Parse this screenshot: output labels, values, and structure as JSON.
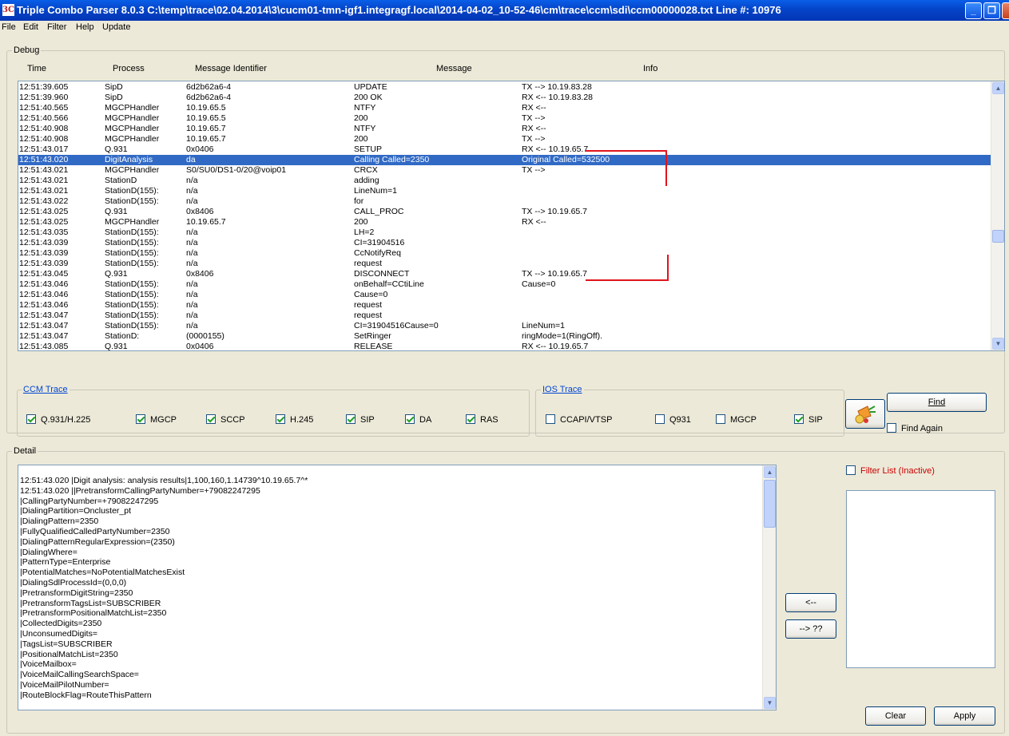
{
  "window": {
    "title": "Triple Combo Parser 8.0.3 C:\\temp\\trace\\02.04.2014\\3\\cucm01-tmn-igf1.integragf.local\\2014-04-02_10-52-46\\cm\\trace\\ccm\\sdi\\ccm00000028.txt Line #: 10976",
    "icon_text": "3C",
    "controls": {
      "minimize": "_",
      "maximize": "❐",
      "close": "✕"
    }
  },
  "menu": [
    "File",
    "Edit",
    "Filter",
    "Help",
    "Update"
  ],
  "debug": {
    "label": "Debug",
    "columns": [
      "Time",
      "Process",
      "Message Identifier",
      "Message",
      "Info"
    ],
    "rows": [
      {
        "time": "12:51:39.605",
        "process": "SipD",
        "msgid": "6d2b62a6-4",
        "message": "UPDATE",
        "info": "TX --> 10.19.83.28"
      },
      {
        "time": "12:51:39.960",
        "process": "SipD",
        "msgid": "6d2b62a6-4",
        "message": "200 OK",
        "info": "RX <-- 10.19.83.28"
      },
      {
        "time": "12:51:40.565",
        "process": "MGCPHandler",
        "msgid": "10.19.65.5",
        "message": "NTFY",
        "info": "RX <--"
      },
      {
        "time": "12:51:40.566",
        "process": "MGCPHandler",
        "msgid": "10.19.65.5",
        "message": "200",
        "info": "TX -->"
      },
      {
        "time": "12:51:40.908",
        "process": "MGCPHandler",
        "msgid": "10.19.65.7",
        "message": "NTFY",
        "info": "RX <--"
      },
      {
        "time": "12:51:40.908",
        "process": "MGCPHandler",
        "msgid": "10.19.65.7",
        "message": "200",
        "info": "TX -->"
      },
      {
        "time": "12:51:43.017",
        "process": "Q.931",
        "msgid": "0x0406",
        "message": "SETUP",
        "info": "RX <-- 10.19.65.7"
      },
      {
        "time": "12:51:43.020",
        "process": "DigitAnalysis",
        "msgid": "da",
        "message": "Calling   Called=2350",
        "info": "Original Called=532500",
        "selected": true
      },
      {
        "time": "12:51:43.021",
        "process": "MGCPHandler",
        "msgid": "S0/SU0/DS1-0/20@voip01",
        "message": "CRCX",
        "info": "TX -->"
      },
      {
        "time": "12:51:43.021",
        "process": "StationD",
        "msgid": "n/a",
        "message": "adding",
        "info": ""
      },
      {
        "time": "12:51:43.021",
        "process": "StationD(155):",
        "msgid": "n/a",
        "message": "LineNum=1",
        "info": ""
      },
      {
        "time": "12:51:43.022",
        "process": "StationD(155):",
        "msgid": "n/a",
        "message": "for",
        "info": ""
      },
      {
        "time": "12:51:43.025",
        "process": "Q.931",
        "msgid": "0x8406",
        "message": "CALL_PROC",
        "info": "TX --> 10.19.65.7"
      },
      {
        "time": "12:51:43.025",
        "process": "MGCPHandler",
        "msgid": "10.19.65.7",
        "message": "200",
        "info": "RX <--"
      },
      {
        "time": "12:51:43.035",
        "process": "StationD(155):",
        "msgid": "n/a",
        "message": "LH=2",
        "info": ""
      },
      {
        "time": "12:51:43.039",
        "process": "StationD(155):",
        "msgid": "n/a",
        "message": "CI=31904516",
        "info": ""
      },
      {
        "time": "12:51:43.039",
        "process": "StationD(155):",
        "msgid": "n/a",
        "message": "CcNotifyReq",
        "info": ""
      },
      {
        "time": "12:51:43.039",
        "process": "StationD(155):",
        "msgid": "n/a",
        "message": "request",
        "info": ""
      },
      {
        "time": "12:51:43.045",
        "process": "Q.931",
        "msgid": "0x8406",
        "message": "DISCONNECT",
        "info": "TX --> 10.19.65.7"
      },
      {
        "time": "12:51:43.046",
        "process": "StationD(155):",
        "msgid": "n/a",
        "message": "onBehalf=CCtiLine",
        "info": "Cause=0"
      },
      {
        "time": "12:51:43.046",
        "process": "StationD(155):",
        "msgid": "n/a",
        "message": "Cause=0",
        "info": ""
      },
      {
        "time": "12:51:43.046",
        "process": "StationD(155):",
        "msgid": "n/a",
        "message": "request",
        "info": ""
      },
      {
        "time": "12:51:43.047",
        "process": "StationD(155):",
        "msgid": "n/a",
        "message": "request",
        "info": ""
      },
      {
        "time": "12:51:43.047",
        "process": "StationD(155):",
        "msgid": "n/a",
        "message": "CI=31904516Cause=0",
        "info": "LineNum=1"
      },
      {
        "time": "12:51:43.047",
        "process": "StationD:",
        "msgid": "(0000155)",
        "message": "SetRinger",
        "info": "ringMode=1(RingOff)."
      },
      {
        "time": "12:51:43.085",
        "process": "Q.931",
        "msgid": "0x0406",
        "message": "RELEASE",
        "info": "RX <-- 10.19.65.7"
      }
    ]
  },
  "ccm_trace": {
    "label": "CCM Trace",
    "options": [
      {
        "label": "Q.931/H.225",
        "checked": true
      },
      {
        "label": "MGCP",
        "checked": true
      },
      {
        "label": "SCCP",
        "checked": true
      },
      {
        "label": "H.245",
        "checked": true
      },
      {
        "label": "SIP",
        "checked": true
      },
      {
        "label": "DA",
        "checked": true
      },
      {
        "label": "RAS",
        "checked": true
      }
    ]
  },
  "ios_trace": {
    "label": "IOS Trace",
    "options": [
      {
        "label": "CCAPI/VTSP",
        "checked": false
      },
      {
        "label": "Q931",
        "checked": false
      },
      {
        "label": "MGCP",
        "checked": false
      },
      {
        "label": "SIP",
        "checked": true
      }
    ]
  },
  "find": {
    "button": "Find",
    "find_again": "Find Again",
    "find_again_checked": false
  },
  "detail": {
    "label": "Detail",
    "lines": [
      "12:51:43.020 |Digit analysis: analysis results|1,100,160,1.14739^10.19.65.7^*",
      "12:51:43.020 ||PretransformCallingPartyNumber=+79082247295",
      "|CallingPartyNumber=+79082247295",
      "|DialingPartition=Oncluster_pt",
      "|DialingPattern=2350",
      "|FullyQualifiedCalledPartyNumber=2350",
      "|DialingPatternRegularExpression=(2350)",
      "|DialingWhere=",
      "|PatternType=Enterprise",
      "|PotentialMatches=NoPotentialMatchesExist",
      "|DialingSdlProcessId=(0,0,0)",
      "|PretransformDigitString=2350",
      "|PretransformTagsList=SUBSCRIBER",
      "|PretransformPositionalMatchList=2350",
      "|CollectedDigits=2350",
      "|UnconsumedDigits=",
      "|TagsList=SUBSCRIBER",
      "|PositionalMatchList=2350",
      "|VoiceMailbox=",
      "|VoiceMailCallingSearchSpace=",
      "|VoiceMailPilotNumber=",
      "|RouteBlockFlag=RouteThisPattern"
    ]
  },
  "nav": {
    "back": "<--",
    "forward": "--> ??"
  },
  "filter_list": {
    "label": "Filter List (Inactive)",
    "label_color": "#cc0000",
    "checked": false
  },
  "bottom_buttons": {
    "clear": "Clear",
    "apply": "Apply"
  },
  "colors": {
    "selection": "#316ac5",
    "titlebar": "#0444c8",
    "annotation": "#e0141c"
  }
}
